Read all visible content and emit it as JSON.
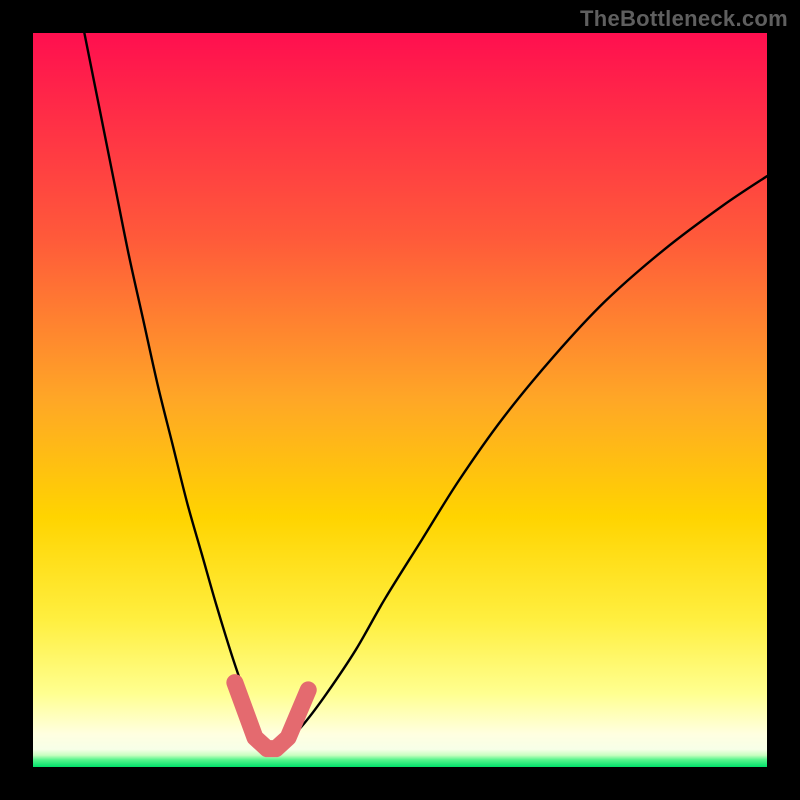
{
  "watermark": "TheBottleneck.com",
  "colors": {
    "bg_black": "#000000",
    "grad_top": "#ff0f4f",
    "grad_mid1": "#ff7a2a",
    "grad_mid2": "#ffd400",
    "grad_mid3": "#ffff6a",
    "grad_light": "#ffffd0",
    "grad_green": "#00e86b",
    "curve": "#000000",
    "peak_marker": "#e46a6f"
  },
  "chart_data": {
    "type": "line",
    "title": "",
    "xlabel": "",
    "ylabel": "",
    "xlim": [
      0,
      100
    ],
    "ylim": [
      0,
      100
    ],
    "series": [
      {
        "name": "bottleneck-curve",
        "x": [
          7,
          9,
          11,
          13,
          15,
          17,
          19,
          21,
          23,
          25,
          27,
          29,
          30.2,
          31,
          32.5,
          34.5,
          37,
          40,
          44,
          48,
          53,
          58,
          64,
          71,
          78,
          86,
          94,
          100
        ],
        "y": [
          100,
          90,
          80,
          70,
          61,
          52,
          44,
          36,
          29,
          22,
          15.5,
          9.5,
          5.5,
          3.2,
          2.9,
          3.4,
          6,
          10,
          16,
          23,
          31,
          39,
          47.5,
          56,
          63.5,
          70.5,
          76.5,
          80.5
        ]
      }
    ],
    "annotations": [
      {
        "name": "optimal-zone",
        "x_range": [
          27.5,
          37.5
        ],
        "y_range": [
          2.5,
          12
        ],
        "shape": "V",
        "note": "highlighted minimum region"
      }
    ],
    "gradient_bands_y_pct_from_bottom": [
      {
        "color": "green",
        "from": 0.0,
        "to": 1.6
      },
      {
        "color": "pale-yellow",
        "from": 1.6,
        "to": 6.0
      },
      {
        "color": "lighter-yellow",
        "from": 6.0,
        "to": 20.0
      },
      {
        "color": "yellow-mid",
        "from": 20.0,
        "to": 42.0
      },
      {
        "color": "orange",
        "from": 42.0,
        "to": 72.0
      },
      {
        "color": "red",
        "from": 72.0,
        "to": 100.0
      }
    ]
  }
}
